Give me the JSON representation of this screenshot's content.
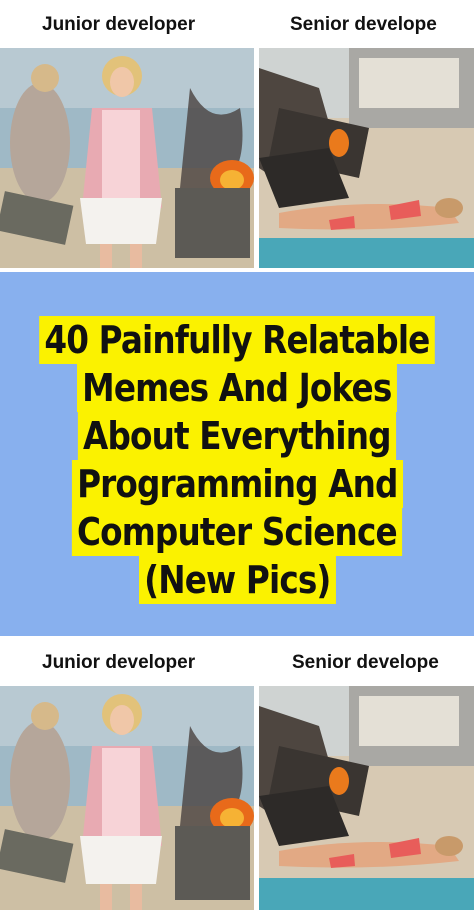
{
  "top_meme": {
    "left_caption": "Junior developer",
    "right_caption": "Senior develope"
  },
  "headline": {
    "lines": [
      "40 Painfully Relatable",
      "Memes And Jokes",
      "About Everything",
      "Programming And",
      "Computer Science",
      "(New Pics)"
    ]
  },
  "bottom_meme": {
    "left_caption": "Junior developer",
    "right_caption": "Senior develope"
  },
  "colors": {
    "banner_background": "#88b0ee",
    "highlight": "#fbf200"
  }
}
